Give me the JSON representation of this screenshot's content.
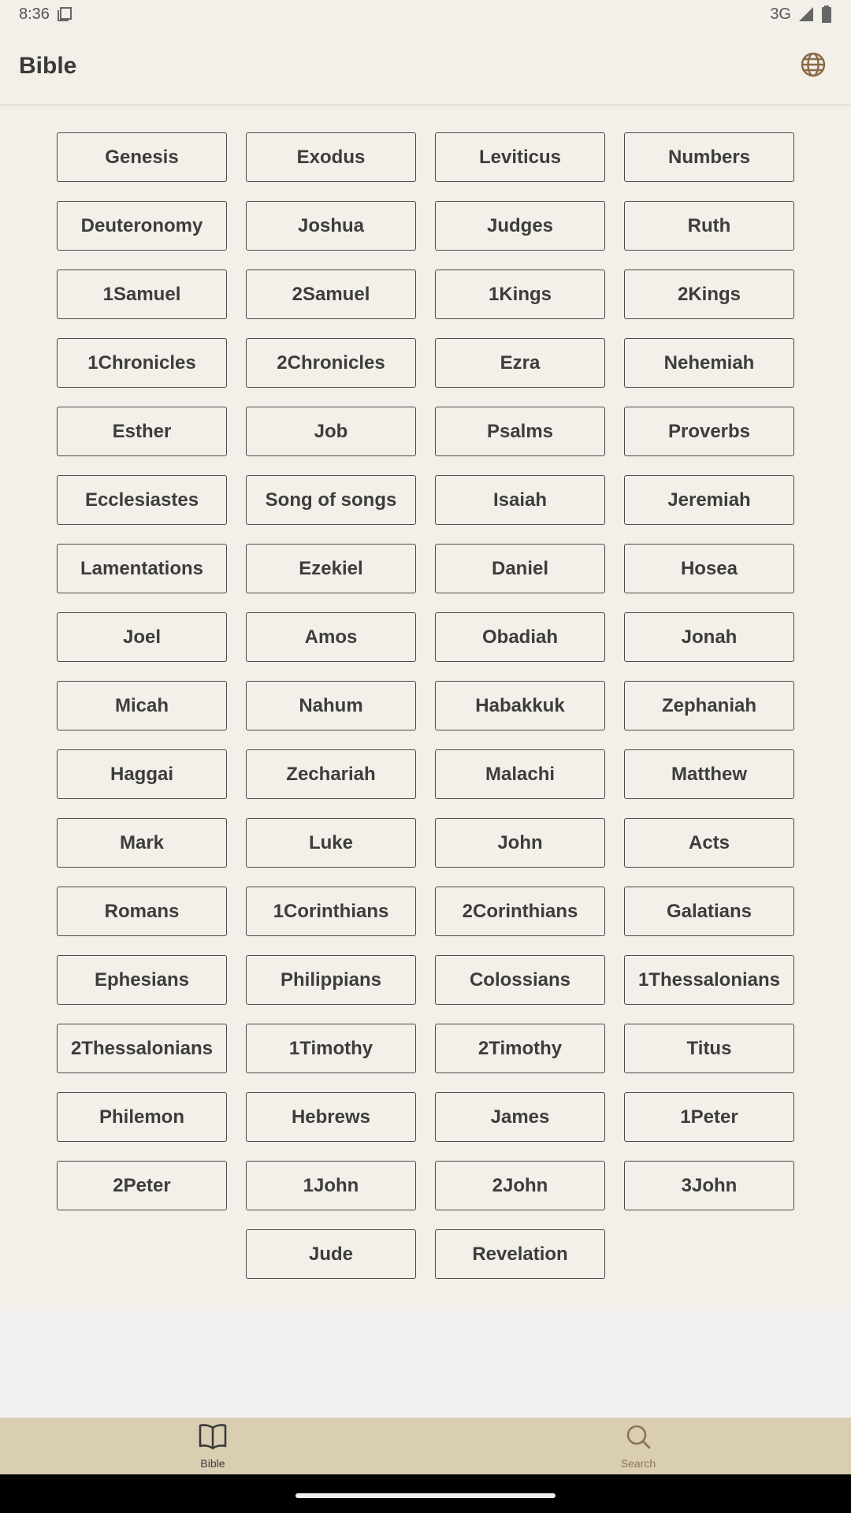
{
  "status_bar": {
    "time": "8:36",
    "network": "3G"
  },
  "app_bar": {
    "title": "Bible",
    "globe_icon": "globe-icon"
  },
  "books": [
    "Genesis",
    "Exodus",
    "Leviticus",
    "Numbers",
    "Deuteronomy",
    "Joshua",
    "Judges",
    "Ruth",
    "1Samuel",
    "2Samuel",
    "1Kings",
    "2Kings",
    "1Chronicles",
    "2Chronicles",
    "Ezra",
    "Nehemiah",
    "Esther",
    "Job",
    "Psalms",
    "Proverbs",
    "Ecclesiastes",
    "Song of songs",
    "Isaiah",
    "Jeremiah",
    "Lamentations",
    "Ezekiel",
    "Daniel",
    "Hosea",
    "Joel",
    "Amos",
    "Obadiah",
    "Jonah",
    "Micah",
    "Nahum",
    "Habakkuk",
    "Zephaniah",
    "Haggai",
    "Zechariah",
    "Malachi",
    "Matthew",
    "Mark",
    "Luke",
    "John",
    "Acts",
    "Romans",
    "1Corinthians",
    "2Corinthians",
    "Galatians",
    "Ephesians",
    "Philippians",
    "Colossians",
    "1Thessalonians",
    "2Thessalonians",
    "1Timothy",
    "2Timothy",
    "Titus",
    "Philemon",
    "Hebrews",
    "James",
    "1Peter",
    "2Peter",
    "1John",
    "2John",
    "3John",
    "Jude",
    "Revelation"
  ],
  "bottom_nav": {
    "items": [
      {
        "label": "Bible",
        "icon": "book-open-icon",
        "active": true
      },
      {
        "label": "Search",
        "icon": "search-icon",
        "active": false
      }
    ]
  },
  "colors": {
    "background": "#f3efe9",
    "nav_background": "#d9ceb2",
    "accent": "#8a7456"
  }
}
